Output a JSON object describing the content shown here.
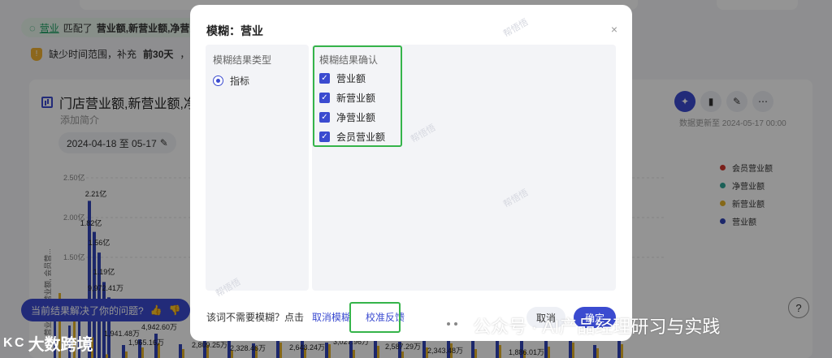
{
  "background": {
    "match_prefix": "营业",
    "match_text": "匹配了",
    "match_terms": "营业额,新营业额,净营业额",
    "warning_text_a": "缺少时间范围，补充",
    "warning_text_b": "前30天",
    "warning_text_c": "，最终",
    "card_title": "门店营业额,新营业额,净营",
    "card_desc": "添加简介",
    "date_range": "2024-04-18 至 05-17",
    "updated": "数据更新至 2024-05-17 00:00",
    "toolbar_icons": [
      "pin-icon",
      "bar-chart-icon",
      "edit-icon",
      "more-icon"
    ],
    "legend": [
      {
        "name": "会员营业额",
        "color": "#d2362e"
      },
      {
        "name": "净营业额",
        "color": "#2fa597"
      },
      {
        "name": "新营业额",
        "color": "#e6b32a"
      },
      {
        "name": "营业额",
        "color": "#3144b8"
      }
    ],
    "feedback_text": "当前结果解决了你的问题?",
    "help": "?"
  },
  "chart_data": {
    "type": "bar",
    "ylabel": "营业额, 净营业额, 会员营...",
    "yticks": [
      "2.50亿",
      "2.00亿",
      "1.50亿"
    ],
    "data_labels": [
      "2.21亿",
      "1.82亿",
      "1.56亿",
      "1.19亿",
      "9,972.41万",
      "4,942.60万",
      "1,965.16万",
      "1,941.48万",
      "2,809.25万",
      "2,328.46万",
      "2,648.24万",
      "3,027.96万",
      "2,587.29万",
      "2,343.48万",
      "1,886.01万"
    ],
    "series": [
      {
        "name": "营业额",
        "values": [
          2.21,
          1.82,
          1.56,
          1.19,
          0.997
        ]
      },
      {
        "name": "新营业额",
        "values": [
          0.494,
          0.197,
          0.194,
          0.281,
          0.233
        ]
      }
    ]
  },
  "modal": {
    "title": "模糊：营业",
    "close": "×",
    "left_header": "模糊结果类型",
    "radio_label": "指标",
    "right_header": "模糊结果确认",
    "options": [
      "营业额",
      "新营业额",
      "净营业额",
      "会员营业额"
    ],
    "footer_prompt": "该词不需要模糊？点击",
    "cancel_fuzzy": "取消模糊",
    "calibrate": "校准反馈",
    "cancel_button": "取消",
    "confirm_button": "确定",
    "watermark": "帮悟悟"
  },
  "watermarks": {
    "brand_text": "公众号 · AI产品经理研习与实践",
    "bottom_left": "大数跨境",
    "bottom_left_logo": "K C"
  },
  "highlight_color": "#35b44a",
  "accent": "#3b4bd0"
}
